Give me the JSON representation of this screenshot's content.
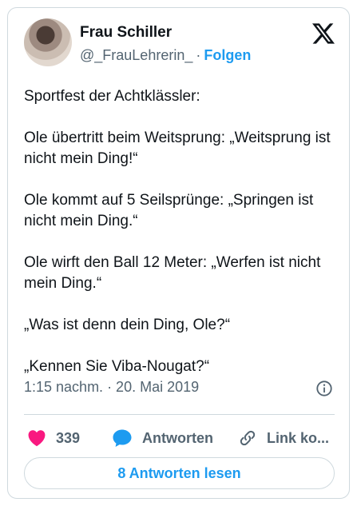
{
  "author": {
    "name": "Frau Schiller",
    "handle": "@_FrauLehrerin_",
    "separator": "·",
    "follow_label": "Folgen"
  },
  "platform_icon": "x-logo-icon",
  "tweet": {
    "lines": [
      "Sportfest der Achtklässler:",
      "Ole übertritt beim Weitsprung: „Weitsprung ist nicht mein Ding!“",
      "Ole kommt auf 5 Seilsprünge: „Springen ist nicht mein Ding.“",
      "Ole wirft den Ball 12 Meter: „Werfen ist nicht mein Ding.“",
      "„Was ist denn dein Ding, Ole?“",
      "„Kennen Sie Viba-Nougat?“"
    ]
  },
  "timestamp": "1:15 nachm. · 20. Mai 2019",
  "actions": {
    "like_count": "339",
    "reply_label": "Antworten",
    "link_label": "Link ko..."
  },
  "read_replies_label": "8 Antworten lesen",
  "colors": {
    "accent": "#1d9bf0",
    "like": "#f91880",
    "secondary_text": "#536471",
    "border": "#cfd9de"
  }
}
